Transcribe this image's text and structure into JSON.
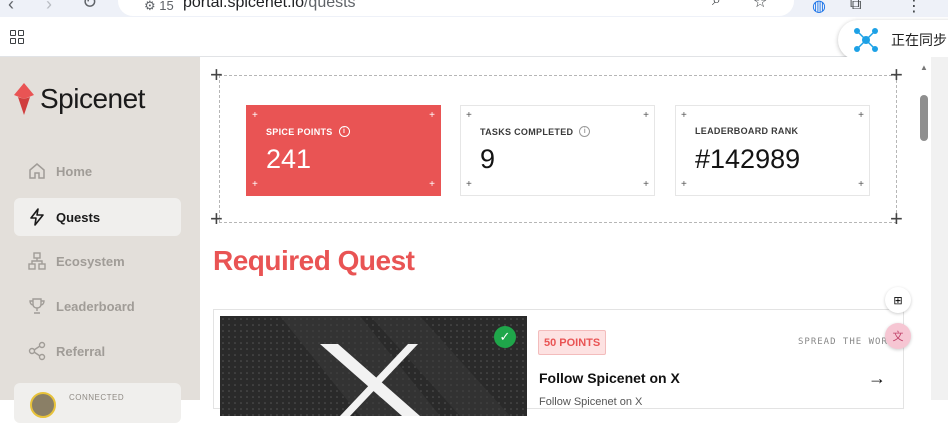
{
  "browser": {
    "tab_count": "15",
    "url_host": "portal.spicenet.io",
    "url_path": "/quests",
    "sync_label": "正在同步"
  },
  "sidebar": {
    "brand": "Spicenet",
    "items": [
      {
        "label": "Home",
        "icon": "home-icon",
        "active": false
      },
      {
        "label": "Quests",
        "icon": "lightning-icon",
        "active": true
      },
      {
        "label": "Ecosystem",
        "icon": "network-icon",
        "active": false
      },
      {
        "label": "Leaderboard",
        "icon": "trophy-icon",
        "active": false
      },
      {
        "label": "Referral",
        "icon": "share-icon",
        "active": false
      }
    ],
    "wallet_status": "CONNECTED"
  },
  "stats": [
    {
      "label": "SPICE POINTS",
      "value": "241",
      "has_info": true
    },
    {
      "label": "TASKS COMPLETED",
      "value": "9",
      "has_info": true
    },
    {
      "label": "LEADERBOARD RANK",
      "value": "#142989",
      "has_info": false
    }
  ],
  "main": {
    "section_title": "Required Quest"
  },
  "quest": {
    "points": "50 POINTS",
    "kind": "SPREAD THE WORD",
    "title": "Follow Spicenet on X",
    "subtitle": "Follow Spicenet on X",
    "completed": true
  },
  "colors": {
    "accent": "#e95454",
    "sidebar_bg": "#e3dfda",
    "success": "#1fa64a"
  }
}
